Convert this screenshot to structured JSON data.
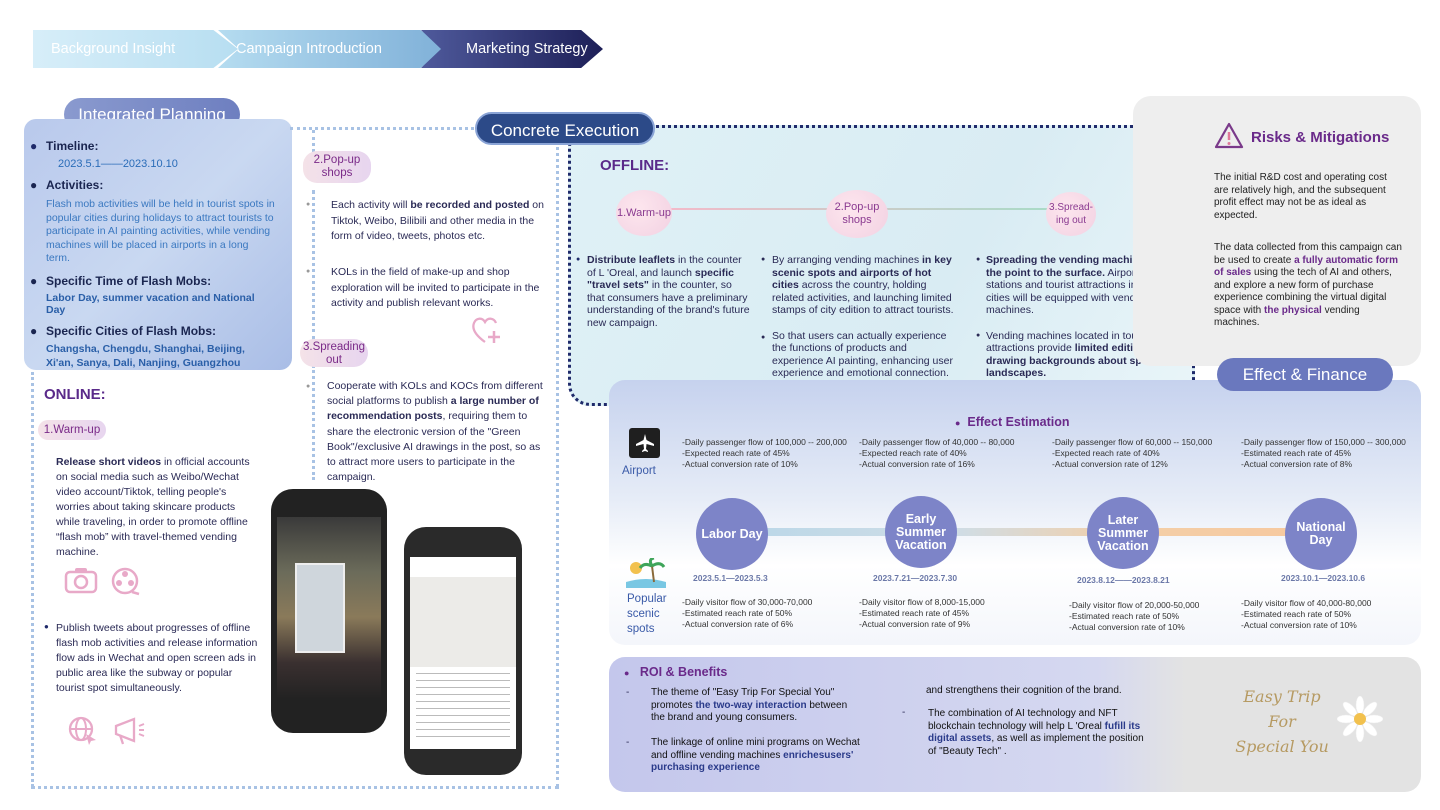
{
  "nav": {
    "steps": [
      "Background Insight",
      "Campaign Introduction",
      "Marketing Strategy"
    ]
  },
  "integrated": {
    "title": "Integrated Planning",
    "timeline_label": "Timeline:",
    "timeline": "2023.5.1——2023.10.10",
    "activities_label": "Activities:",
    "activities": "Flash mob activities will be held in tourist spots in popular cities during holidays to attract tourists to participate in AI painting activities, while vending machines will be placed in airports in a long term.",
    "time_label": "Specific Time of Flash Mobs:",
    "time": "Labor Day, summer vacation and National Day",
    "cities_label": "Specific Cities of Flash Mobs:",
    "cities": "Changsha, Chengdu, Shanghai, Beijing, Xi'an, Sanya, Dali, Nanjing, Guangzhou"
  },
  "online": {
    "title": "ONLINE:",
    "warmup_tag": "1.Warm-up",
    "warmup_bold": "Release short videos",
    "warmup_text": " in official accounts on social media such as Weibo/Wechat video account/Tiktok, telling people's worries about taking skincare products while traveling, in order to promote offline “flash mob” with travel-themed vending machine.",
    "tweets_text": "Publish tweets about progresses of offline flash mob activities and release information flow ads in Wechat and open screen ads in public area like the subway or popular tourist spot simultaneously.",
    "popup_tag": "2.Pop-up shops",
    "popup_pre": "Each activity will ",
    "popup_bold": "be recorded and posted",
    "popup_post": " on Tiktok, Weibo, Bilibili and other media in the form of video, tweets, photos etc.",
    "kols_text": "KOLs in the field of make-up and shop exploration will be invited to participate in the activity and publish relevant works.",
    "spread_tag": "3.Spreading out",
    "spread_pre": "Cooperate with KOLs and KOCs from different social platforms to publish ",
    "spread_bold": "a large number of recommendation posts",
    "spread_post": ", requiring them to share the electronic version of the \"Green Book\"/exclusive AI drawings in the post, so as to attract more users to participate in the campaign."
  },
  "execution": {
    "title": "Concrete Execution",
    "offline": "OFFLINE:",
    "steps": [
      "1.Warm-up",
      "2.Pop-up shops",
      "3.Spread-ing out"
    ],
    "col1_b1": "Distribute leaflets",
    "col1_t1": " in the counter of L 'Oreal, and launch ",
    "col1_b2": "specific \"travel sets\"",
    "col1_t2": " in the counter, so that consumers have a preliminary understanding of the brand's future new campaign.",
    "col2_t1": "By arranging vending machines ",
    "col2_b1": "in key scenic spots and airports of hot cities",
    "col2_t2": " across the country, holding related activities, and launching limited stamps of city edition to attract tourists.",
    "col2_p2": "So that users can actually experience the functions of products and experience AI painting, enhancing user experience and emotional connection.",
    "col3_b1": "Spreading the vending machine from the point to the surface.",
    "col3_t1": " Airports, train stations and tourist attractions in popular cities will be equipped with vending machines.",
    "col3_t2": "Vending machines located in tourist attractions provide ",
    "col3_b2": "limited edition of AI drawing backgrounds about specific landscapes."
  },
  "risks": {
    "title": "Risks & Mitigations",
    "p1": "The initial R&D cost and operating cost are relatively high, and the subsequent profit effect may not be as ideal as expected.",
    "p2_pre": "The data collected from this campaign can be used to create ",
    "p2_b1": "a fully automatic form of sales",
    "p2_mid": " using the tech of AI and others, and explore a new form of purchase experience combining the virtual digital space with ",
    "p2_b2": "the physical",
    "p2_post": " vending machines."
  },
  "effect": {
    "title": "Effect & Finance",
    "estimation": "Effect Estimation",
    "airport_label": "Airport",
    "scenic_label": "Popular scenic spots",
    "seasons": [
      {
        "name": "Labor Day",
        "date": "2023.5.1—2023.5.3",
        "airport": [
          "-Daily passenger flow of 100,000 -- 200,000",
          "-Expected reach rate of 45%",
          "-Actual conversion rate of 10%"
        ],
        "scenic": [
          "-Daily visitor flow of 30,000-70,000",
          "-Estimated reach rate of 50%",
          "-Actual conversion rate of 6%"
        ]
      },
      {
        "name": "Early Summer Vacation",
        "date": "2023.7.21—2023.7.30",
        "airport": [
          "-Daily passenger flow of 40,000 -- 80,000",
          "-Expected reach rate of 40%",
          "-Actual conversion rate of 16%"
        ],
        "scenic": [
          "-Daily visitor flow of 8,000-15,000",
          "-Estimated reach rate of 45%",
          "-Actual conversion rate of 9%"
        ]
      },
      {
        "name": "Later Summer Vacation",
        "date": "2023.8.12——2023.8.21",
        "airport": [
          "-Daily passenger flow of 60,000 -- 150,000",
          "-Expected reach rate of 40%",
          "-Actual conversion rate of 12%"
        ],
        "scenic": [
          "-Daily visitor flow of 20,000-50,000",
          "-Estimated reach rate of 50%",
          "-Actual conversion rate of 10%"
        ]
      },
      {
        "name": "National Day",
        "date": "2023.10.1—2023.10.6",
        "airport": [
          "-Daily passenger flow of 150,000 -- 300,000",
          "-Estimated reach rate of 45%",
          "-Actual conversion rate of 8%"
        ],
        "scenic": [
          "-Daily visitor flow of 40,000-80,000",
          "-Estimated reach rate of 50%",
          "-Actual conversion rate of 10%"
        ]
      }
    ]
  },
  "roi": {
    "title": "ROI & Benefits",
    "i1_pre": "The theme of \"Easy Trip For Special You\" promotes ",
    "i1_b": "the two-way interaction",
    "i1_post": " between the brand and young consumers.",
    "i2_pre": "The linkage of online mini programs on Wechat and offline vending machines ",
    "i2_b": "enrichesusers' purchasing experience",
    "i3": "and strengthens their cognition of the brand.",
    "i4_pre": "The combination of AI technology and NFT blockchain technology will help L 'Oreal ",
    "i4_b": "fufill its digital assets",
    "i4_post": ", as well as implement the position of  \"Beauty Tech\" .",
    "slogan": [
      "Easy Trip",
      "For",
      "Special You"
    ]
  },
  "colors": {
    "navy": "#1f2a6a",
    "purple": "#6a2a8a",
    "accent_blue": "#2a6cb8"
  }
}
